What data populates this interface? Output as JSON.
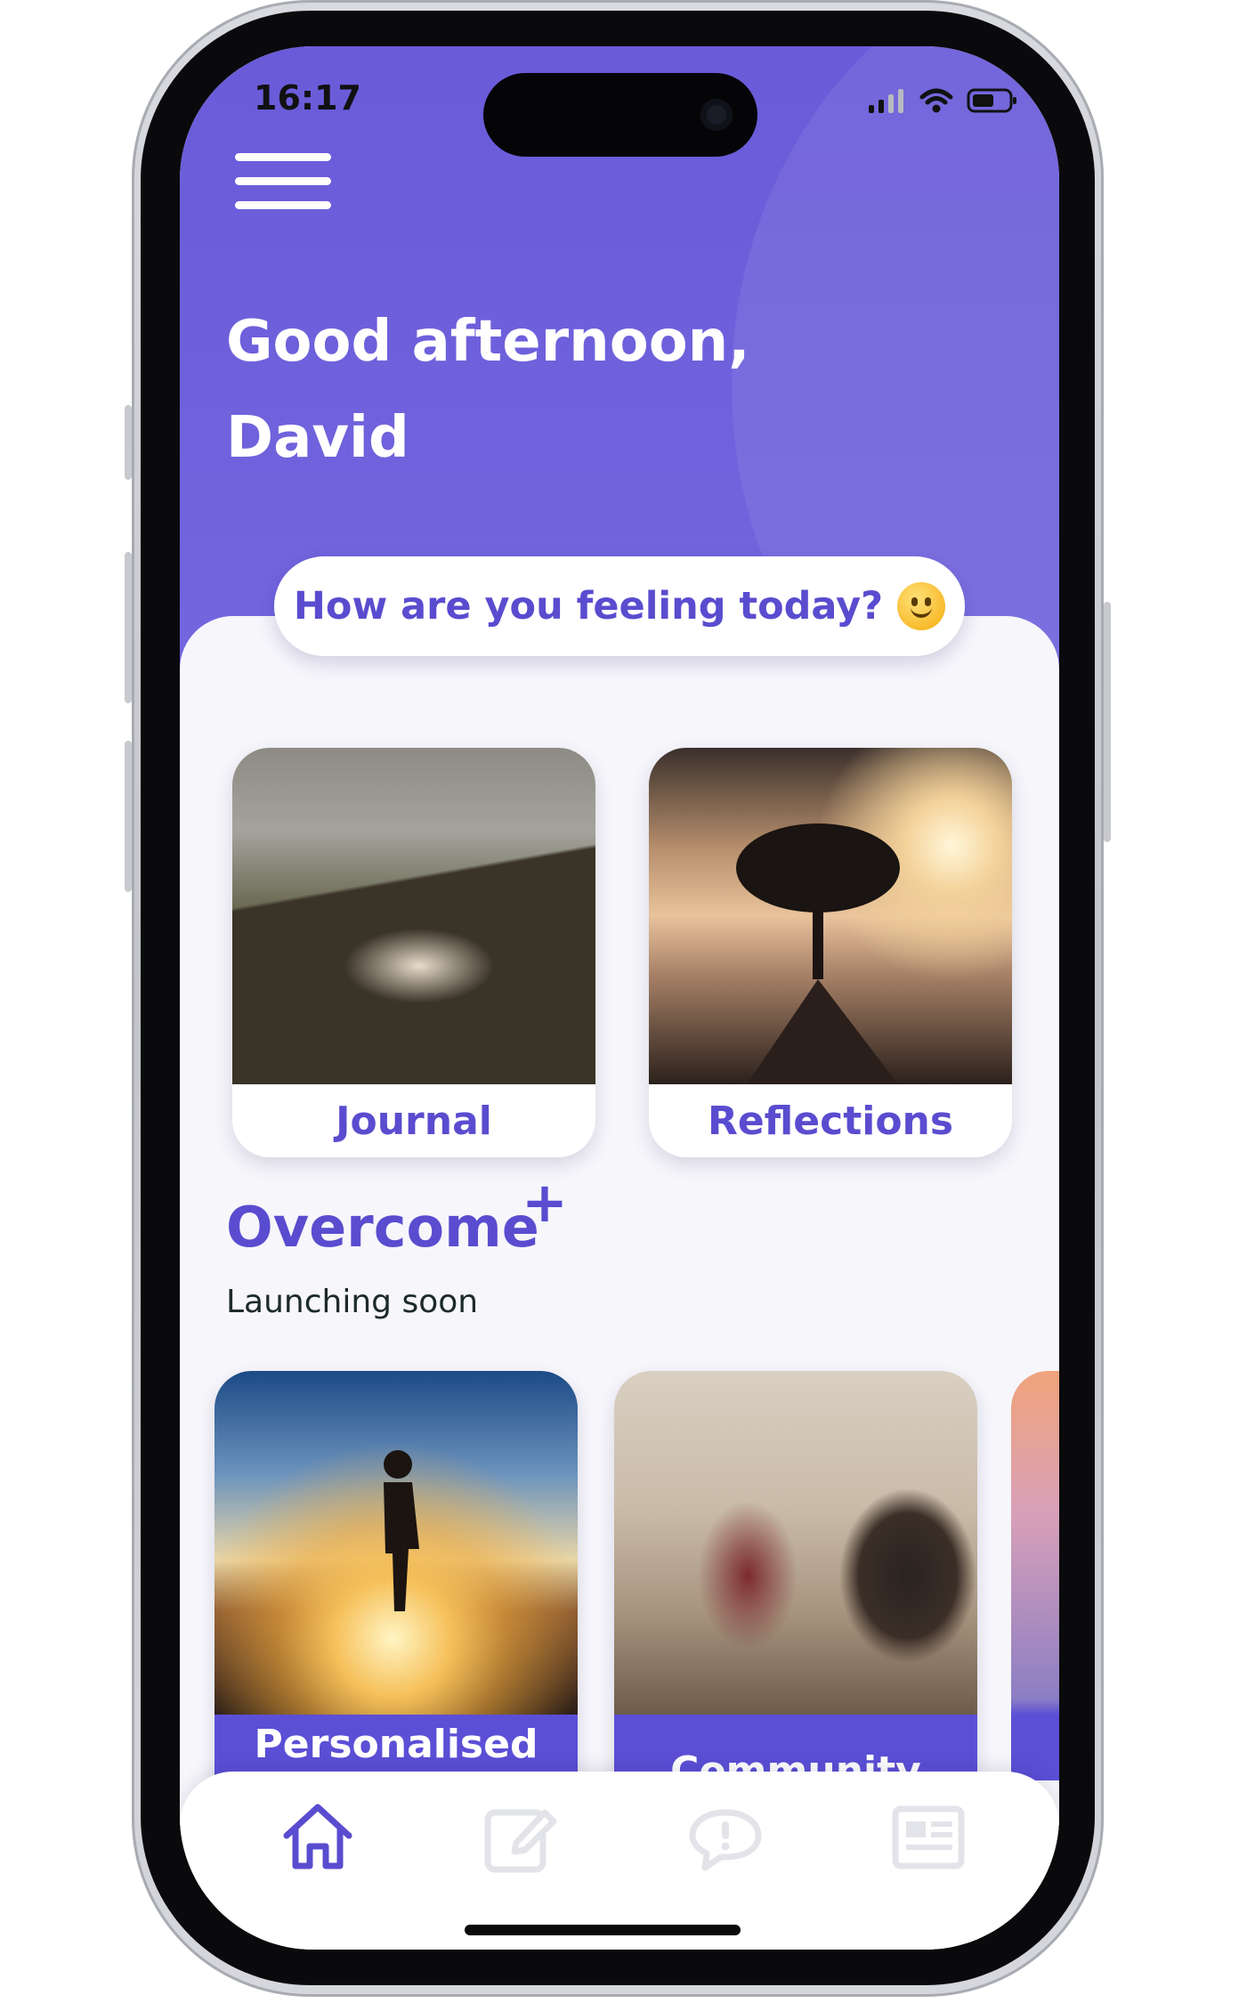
{
  "status_bar": {
    "time": "16:17"
  },
  "header": {
    "greeting_line1": "Good afternoon,",
    "greeting_line2": "David"
  },
  "mood_prompt": {
    "label": "How are you feeling today?",
    "emoji": "slightly-smiling-face"
  },
  "feature_cards": [
    {
      "label": "Journal",
      "image": "person-writing-in-notebook"
    },
    {
      "label": "Reflections",
      "image": "tree-at-sunrise"
    }
  ],
  "overcome": {
    "title": "Overcome",
    "title_mark": "+",
    "subtitle": "Launching soon",
    "cards": [
      {
        "label": "Personalised",
        "image": "runner-on-road-sunrise"
      },
      {
        "label": "Community",
        "image": "people-in-conversation"
      }
    ]
  },
  "bottom_nav": [
    {
      "icon": "home-icon",
      "active": true
    },
    {
      "icon": "edit-icon",
      "active": false
    },
    {
      "icon": "chat-alert-icon",
      "active": false
    },
    {
      "icon": "news-icon",
      "active": false
    }
  ],
  "colors": {
    "primary": "#5a4ccf",
    "header": "#6c5ddb",
    "background": "#f6f6fb",
    "inactive_icon": "#e3e4ea"
  }
}
